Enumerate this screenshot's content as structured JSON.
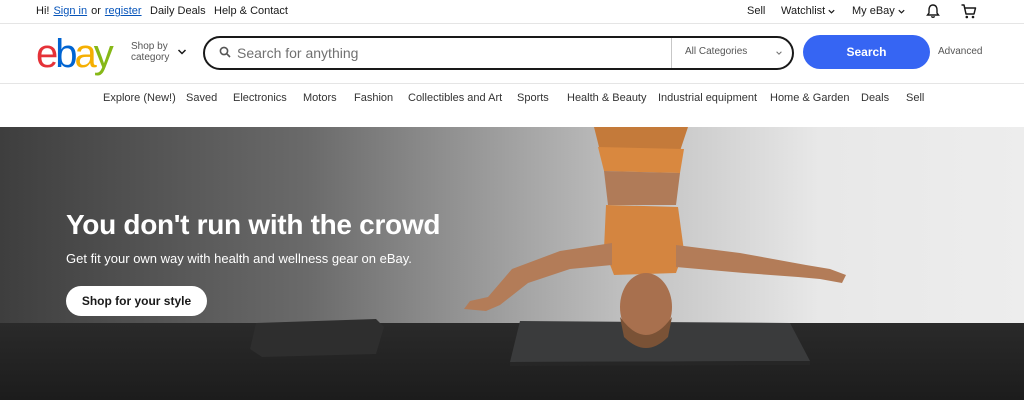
{
  "topbar": {
    "greeting": "Hi!",
    "signin": "Sign in",
    "or": "or",
    "register": "register",
    "daily_deals": "Daily Deals",
    "help": "Help & Contact",
    "sell": "Sell",
    "watchlist": "Watchlist",
    "myebay": "My eBay",
    "icons": [
      "bell-icon",
      "cart-icon"
    ]
  },
  "header": {
    "logo": {
      "e": "e",
      "b": "b",
      "a": "a",
      "y": "y"
    },
    "logo_colors": [
      "#e53238",
      "#0064d2",
      "#f5af02",
      "#86b817"
    ],
    "shop_by_line1": "Shop by",
    "shop_by_line2": "category",
    "search": {
      "placeholder": "Search for anything",
      "value": "",
      "category": "All Categories",
      "button": "Search",
      "button_color": "#3665f3"
    },
    "advanced": "Advanced"
  },
  "nav": {
    "items": [
      "Explore (New!)",
      "Saved",
      "Electronics",
      "Motors",
      "Fashion",
      "Collectibles and Art",
      "Sports",
      "Health & Beauty",
      "Industrial equipment",
      "Home & Garden",
      "Deals",
      "Sell"
    ]
  },
  "hero": {
    "title": "You don't run with the crowd",
    "subtitle": "Get fit your own way with health and wellness gear on eBay.",
    "cta": "Shop for your style"
  }
}
